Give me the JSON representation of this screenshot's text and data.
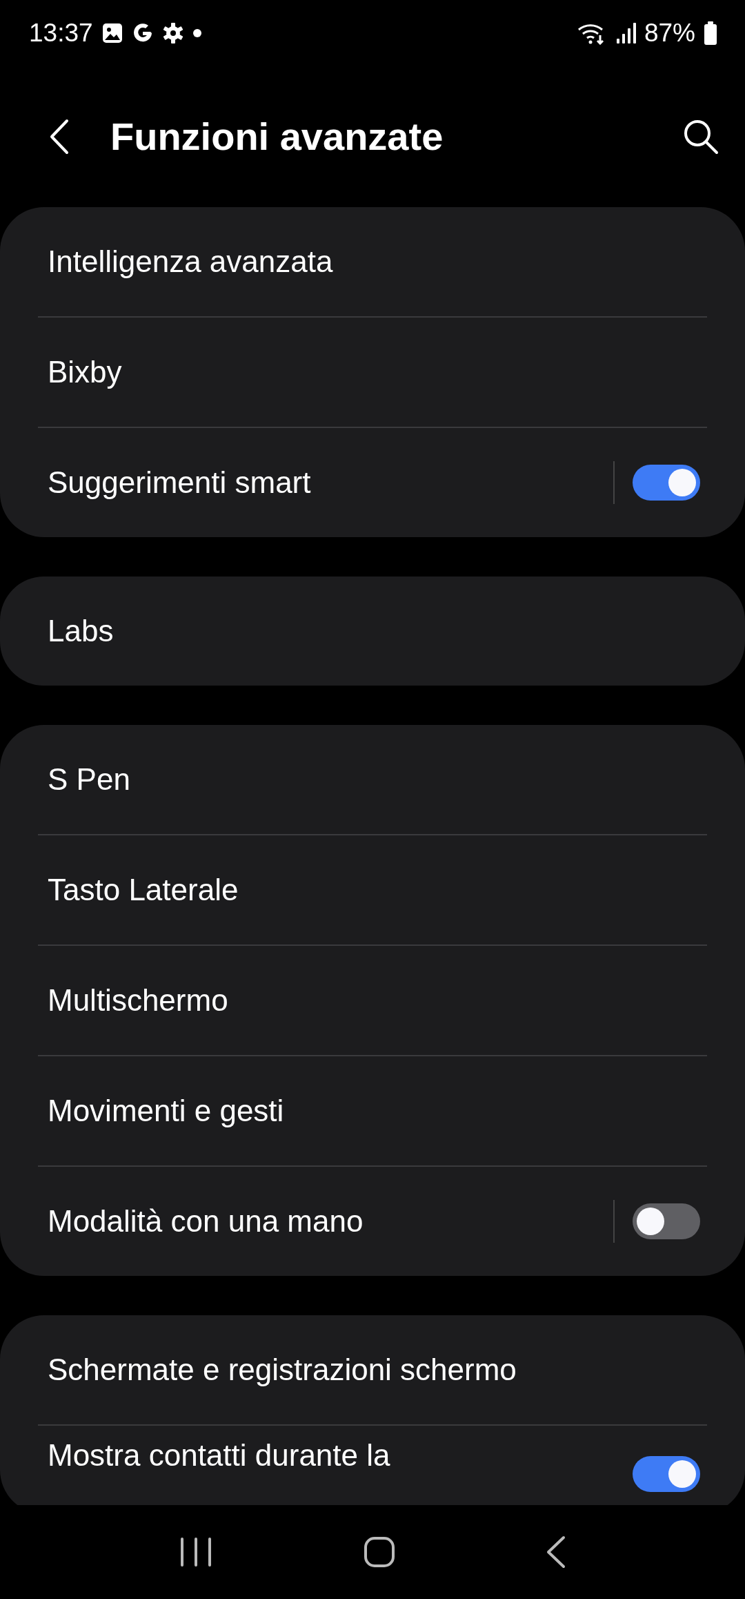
{
  "status_bar": {
    "time": "13:37",
    "battery": "87%"
  },
  "header": {
    "title": "Funzioni avanzate"
  },
  "groups": [
    {
      "items": [
        {
          "label": "Intelligenza avanzata",
          "kind": "link"
        },
        {
          "label": "Bixby",
          "kind": "link"
        },
        {
          "label": "Suggerimenti smart",
          "kind": "switch",
          "on": true
        }
      ]
    },
    {
      "items": [
        {
          "label": "Labs",
          "kind": "link"
        }
      ]
    },
    {
      "items": [
        {
          "label": "S Pen",
          "kind": "link"
        },
        {
          "label": "Tasto Laterale",
          "kind": "link"
        },
        {
          "label": "Multischermo",
          "kind": "link"
        },
        {
          "label": "Movimenti e gesti",
          "kind": "link"
        },
        {
          "label": "Modalità con una mano",
          "kind": "switch",
          "on": false
        }
      ]
    },
    {
      "items": [
        {
          "label": "Schermate e registrazioni schermo",
          "kind": "link"
        },
        {
          "label": "Mostra contatti durante la",
          "kind": "switch",
          "on": true
        }
      ]
    }
  ]
}
